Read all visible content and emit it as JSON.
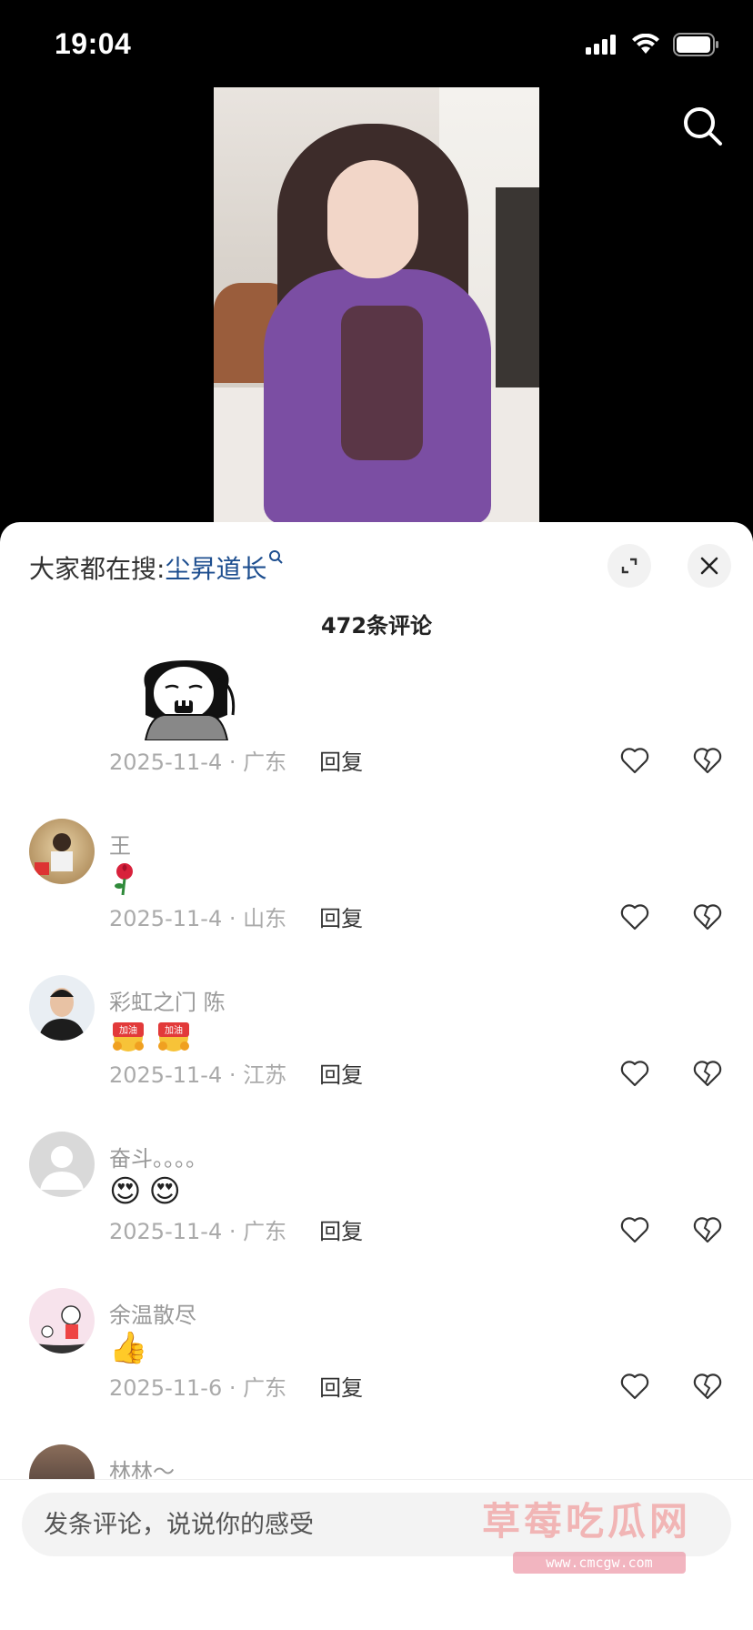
{
  "status": {
    "time": "19:04"
  },
  "sheet": {
    "trend_prefix": "大家都在搜:",
    "trend_keyword": "尘昇道长",
    "comment_count": "472条评论"
  },
  "comments": [
    {
      "date_loc": "2025-11-4 · 广东",
      "reply": "回复"
    },
    {
      "name": "王",
      "emoji": [
        "🌹"
      ],
      "date_loc": "2025-11-4 · 山东",
      "reply": "回复"
    },
    {
      "name": "彩虹之门 陈",
      "emoji": [
        "加油",
        "加油"
      ],
      "date_loc": "2025-11-4 · 江苏",
      "reply": "回复"
    },
    {
      "name": "奋斗。。。。",
      "emoji": [
        "😍",
        "😍"
      ],
      "date_loc": "2025-11-4 · 广东",
      "reply": "回复"
    },
    {
      "name": "余温散尽",
      "emoji": [
        "👍"
      ],
      "date_loc": "2025-11-6 · 广东",
      "reply": "回复"
    },
    {
      "name": "林林～"
    }
  ],
  "input": {
    "placeholder": "发条评论，说说你的感受"
  },
  "watermark": {
    "title": "草莓吃瓜网",
    "url": "www.cmcgw.com"
  },
  "colors": {
    "keyword": "#1d4e8f",
    "coat": "#7b4ea3"
  }
}
